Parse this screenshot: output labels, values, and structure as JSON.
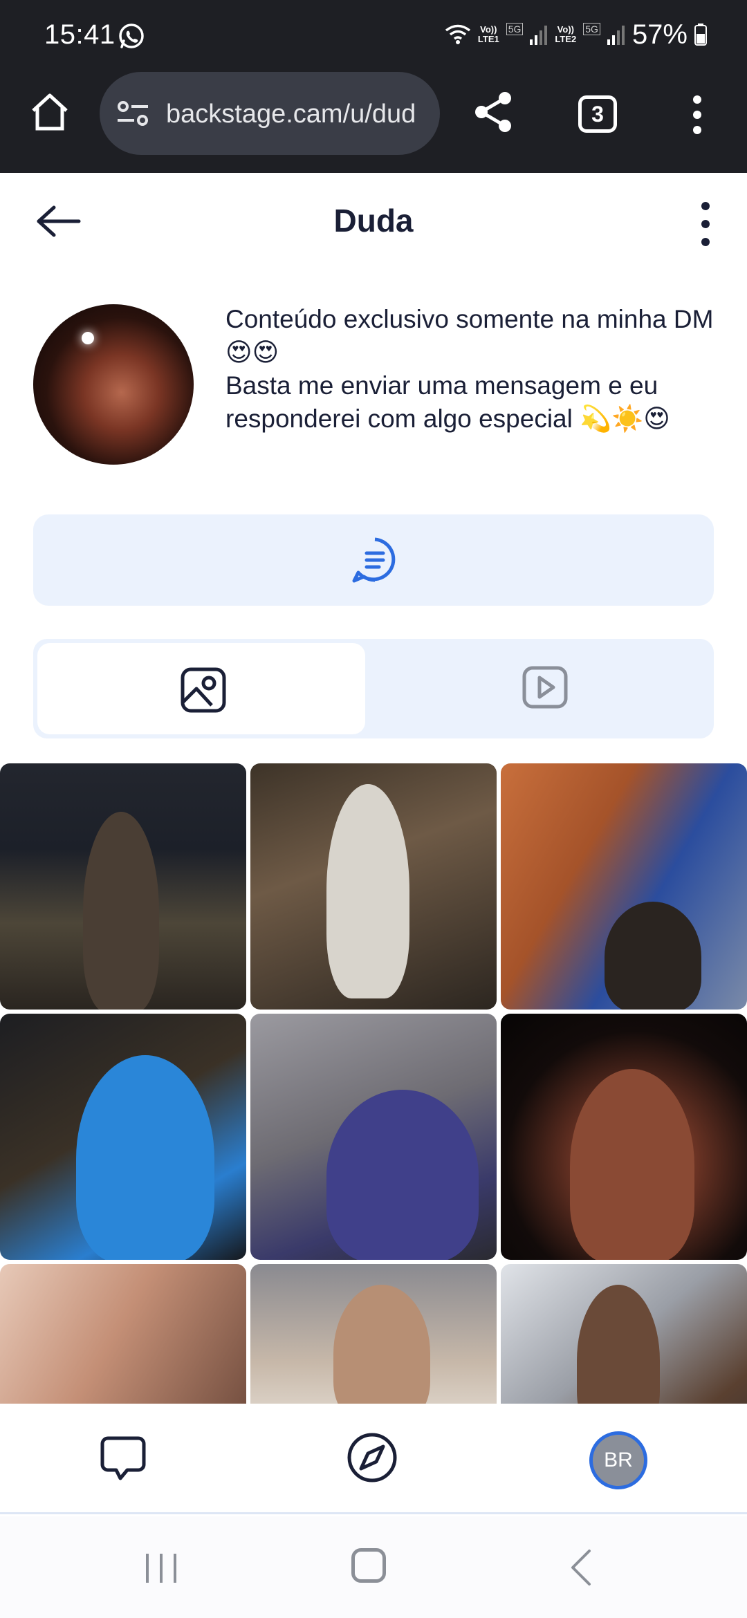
{
  "status_bar": {
    "time": "15:41",
    "battery": "57%",
    "sim1": "LTE1",
    "sim2": "LTE2",
    "network": "5G",
    "volte": "Vo))"
  },
  "browser": {
    "url": "backstage.cam/u/dud",
    "tab_count": "3"
  },
  "header": {
    "title": "Duda"
  },
  "profile": {
    "bio_line1": "Conteúdo exclusivo somente na minha DM 😍😍",
    "bio_line2": "Basta me enviar uma mensagem e eu responderei com algo especial 💫☀️😍"
  },
  "tabs": [
    {
      "name": "photos",
      "icon": "image-icon",
      "selected": true
    },
    {
      "name": "videos",
      "icon": "play-icon",
      "selected": false
    }
  ],
  "bottom_nav": {
    "profile_initials": "BR"
  },
  "colors": {
    "accent": "#2c6ce0",
    "chrome_bg": "#1e1f24",
    "soft_blue": "#ebf2fd",
    "text_dark": "#1a1f36"
  }
}
